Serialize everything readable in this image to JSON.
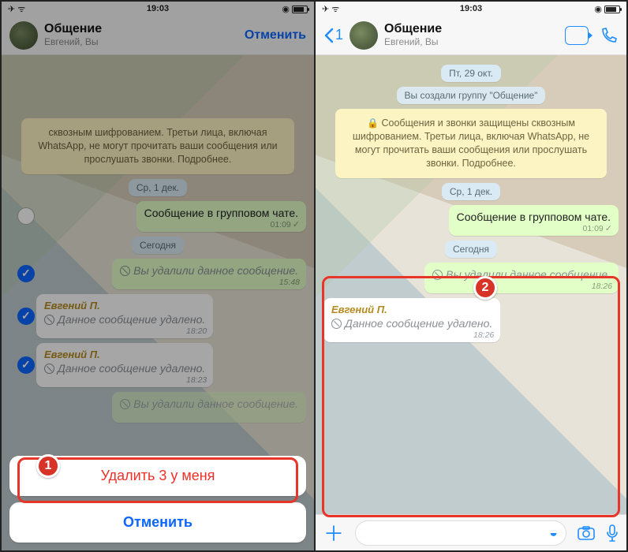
{
  "status": {
    "time": "19:03",
    "plane": "✈",
    "wifi": "⎋"
  },
  "header": {
    "title": "Общение",
    "subtitle": "Евгений, Вы",
    "back_count": "1",
    "cancel": "Отменить"
  },
  "encryption_banner_short": "сквозным шифрованием. Третьи лица, включая WhatsApp, не могут прочитать ваши сообщения или прослушать звонки. Подробнее.",
  "encryption_banner_full": "Сообщения и звонки защищены сквозным шифрованием. Третьи лица, включая WhatsApp, не могут прочитать ваши сообщения или прослушать звонки. Подробнее.",
  "group_created": "Вы создали группу \"Общение\"",
  "dates": {
    "fri": "Пт, 29 окт.",
    "wed": "Ср, 1 дек.",
    "today": "Сегодня"
  },
  "msgs": {
    "group_msg": "Сообщение в групповом чате.",
    "group_msg_time": "01:09",
    "you_deleted": "Вы удалили данное сообщение.",
    "you_deleted_time_a": "15:48",
    "you_deleted_time_b": "18:26",
    "sender": "Евгений П.",
    "deleted": "Данное сообщение удалено.",
    "deleted_time_a": "18:20",
    "deleted_time_b": "18:23",
    "deleted_time_c": "18:26"
  },
  "sheet": {
    "delete": "Удалить 3 у меня",
    "cancel": "Отменить"
  },
  "badges": {
    "one": "1",
    "two": "2"
  }
}
